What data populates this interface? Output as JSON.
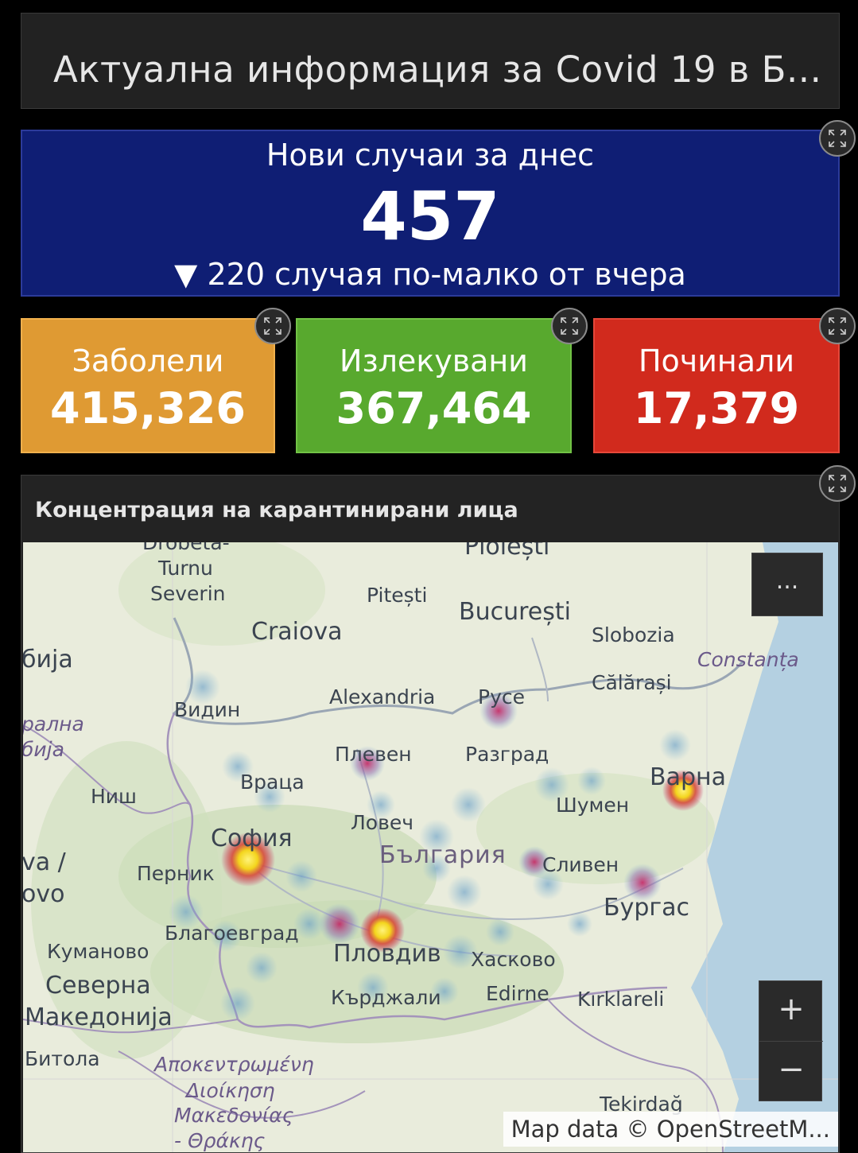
{
  "header": {
    "title": "Актуална информация за Covid 19 в Б..."
  },
  "new_cases": {
    "label": "Нови случаи за днес",
    "value": "457",
    "trend_arrow": "▼",
    "trend_text": "220 случая по-малко от вчера"
  },
  "stats": {
    "infected": {
      "label": "Заболели",
      "value": "415,326",
      "color": "#df9a33"
    },
    "recovered": {
      "label": "Излекувани",
      "value": "367,464",
      "color": "#58a92e"
    },
    "deaths": {
      "label": "Починали",
      "value": "17,379",
      "color": "#d12a1d"
    }
  },
  "map": {
    "title": "Концентрация на карантинирани лица",
    "menu_label": "...",
    "zoom_in_label": "+",
    "zoom_out_label": "−",
    "attribution": "Map data © OpenStreetM...",
    "places": {
      "drobeta": "Drobeta-",
      "turnu": "Turnu",
      "severin": "Severin",
      "ploiesti": "Ploiești",
      "pitesti": "Pitești",
      "bucuresti": "București",
      "craiova": "Craiova",
      "slobozia": "Slobozia",
      "constanta": "Constanța",
      "calarasi": "Călărași",
      "alexandria": "Alexandria",
      "ruse": "Русе",
      "vidin": "Видин",
      "srbija": "бија",
      "centralna": "рална",
      "srbija2": "бија",
      "pleven": "Плевен",
      "razgrad": "Разград",
      "vratsa": "Враца",
      "nish": "Ниш",
      "varna": "Варна",
      "shumen": "Шумен",
      "lovech": "Ловеч",
      "sofia": "София",
      "bulgaria": "България",
      "sliven": "Сливен",
      "va": "va /",
      "ovo": "ovo",
      "pernik": "Перник",
      "burgas": "Бургас",
      "blagoevgrad": "Благоевград",
      "kumanovo": "Куманово",
      "plovdiv": "Пловдив",
      "haskovo": "Хасково",
      "severna": "Северна",
      "edirne": "Edirne",
      "kardzhali": "Кърджали",
      "kirklareli": "Kırklareli",
      "makedonija": "Македонија",
      "bitola": "Битола",
      "apokentr": "Αποκεντρωμένη",
      "dioikisi": "Διοίκηση",
      "makedonias": "Μακεδονίας",
      "thrakis": "- Θράκης",
      "tekirdag": "Tekirdağ"
    },
    "heat_color_high": "#f3d51d",
    "heat_color_mid": "#c2185b",
    "heat_color_low": "#7fb3d5"
  }
}
